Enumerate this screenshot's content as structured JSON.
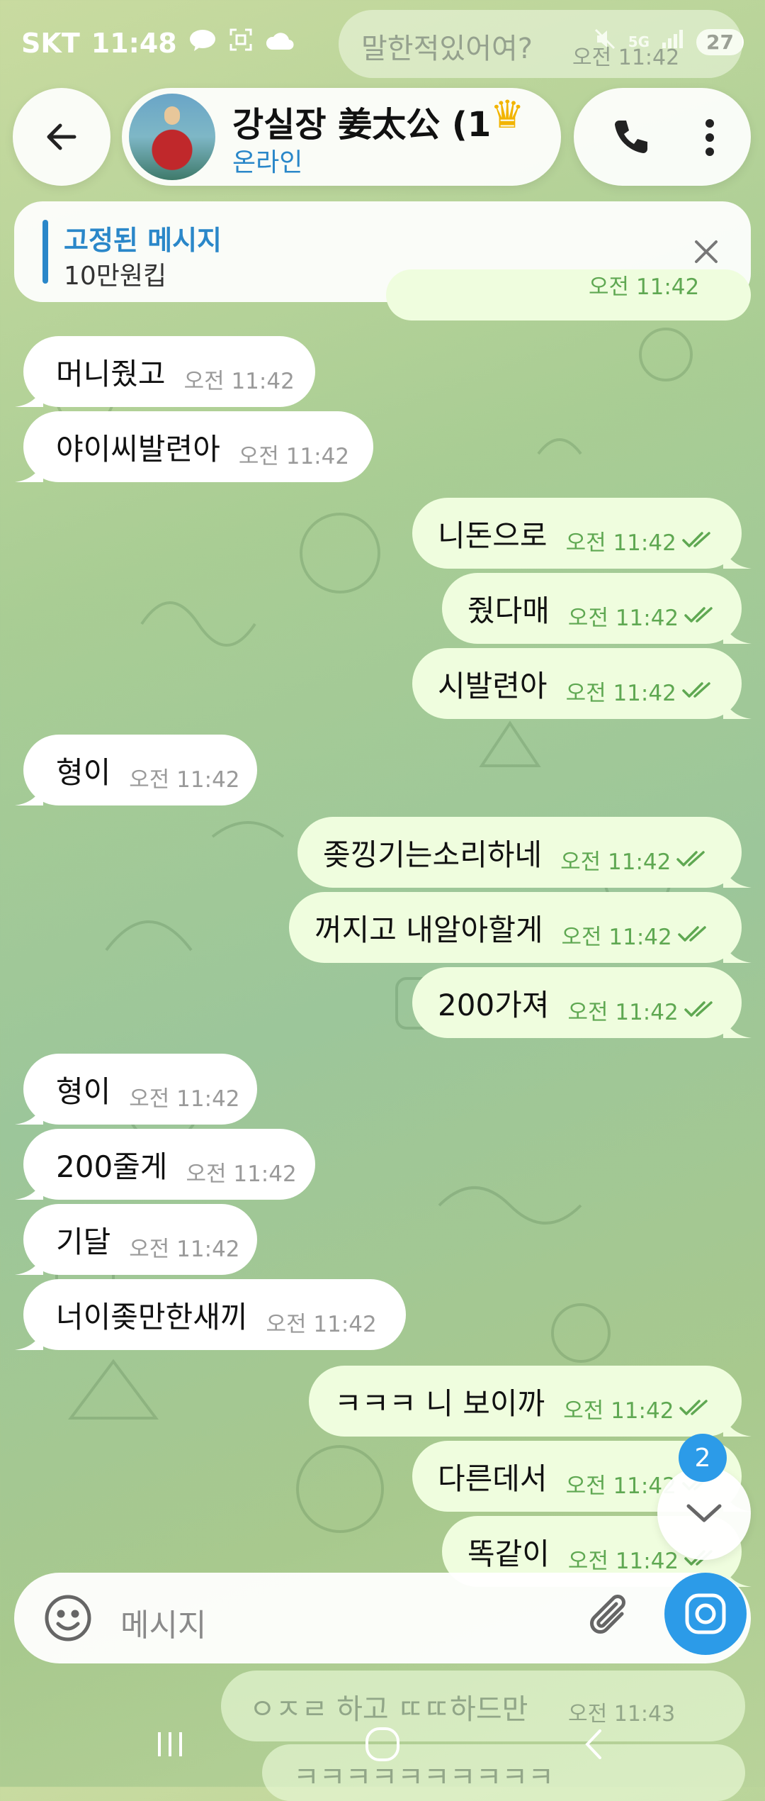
{
  "status_bar": {
    "carrier": "SKT",
    "time": "11:48",
    "battery": "27",
    "network": "5G"
  },
  "ghost_top_message": {
    "text": "말한적있어여?",
    "time": "오전 11:42"
  },
  "header": {
    "title": "강실장 姜太公 (1",
    "subtitle": "온라인"
  },
  "pinned": {
    "title": "고정된 메시지",
    "text": "10만원킵",
    "hidden_time": "오전 11:42"
  },
  "messages": [
    {
      "dir": "in",
      "text": "머니줬고",
      "time": "오전 11:42"
    },
    {
      "dir": "in",
      "text": "야이씨발련아",
      "time": "오전 11:42"
    },
    {
      "dir": "out",
      "text": "니돈으로",
      "time": "오전 11:42"
    },
    {
      "dir": "out",
      "text": "줬다매",
      "time": "오전 11:42"
    },
    {
      "dir": "out",
      "text": "시발련아",
      "time": "오전 11:42"
    },
    {
      "dir": "in",
      "text": "형이",
      "time": "오전 11:42"
    },
    {
      "dir": "out",
      "text": "좆낑기는소리하네",
      "time": "오전 11:42"
    },
    {
      "dir": "out",
      "text": "꺼지고 내알아할게",
      "time": "오전 11:42"
    },
    {
      "dir": "out",
      "text": "200가져",
      "time": "오전 11:42"
    },
    {
      "dir": "in",
      "text": "형이",
      "time": "오전 11:42"
    },
    {
      "dir": "in",
      "text": "200줄게",
      "time": "오전 11:42"
    },
    {
      "dir": "in",
      "text": "기달",
      "time": "오전 11:42"
    },
    {
      "dir": "in",
      "text": "너이좆만한새끼",
      "time": "오전 11:42"
    },
    {
      "dir": "out",
      "text": "ㅋㅋㅋ 니 보이까",
      "time": "오전 11:42"
    },
    {
      "dir": "out",
      "text": "다른데서",
      "time": "오전 11:42"
    },
    {
      "dir": "out",
      "text": "똑같이",
      "time": "오전 11:42"
    }
  ],
  "ghost_bottom": [
    {
      "text": "ㅇㅈㄹ 하고 ㄸㄸ하드만",
      "time": "오전 11:43"
    },
    {
      "text": "ㅋㅋㅋㅋㅋㅋㅋㅋㅋㅋ"
    }
  ],
  "scroll_down": {
    "badge": "2"
  },
  "input": {
    "placeholder": "메시지"
  },
  "colors": {
    "accent": "#2c9be8",
    "link_blue": "#2a87c9",
    "outgoing_bubble": "#effdde",
    "incoming_bubble": "#ffffff",
    "check_green": "#5fa852"
  }
}
